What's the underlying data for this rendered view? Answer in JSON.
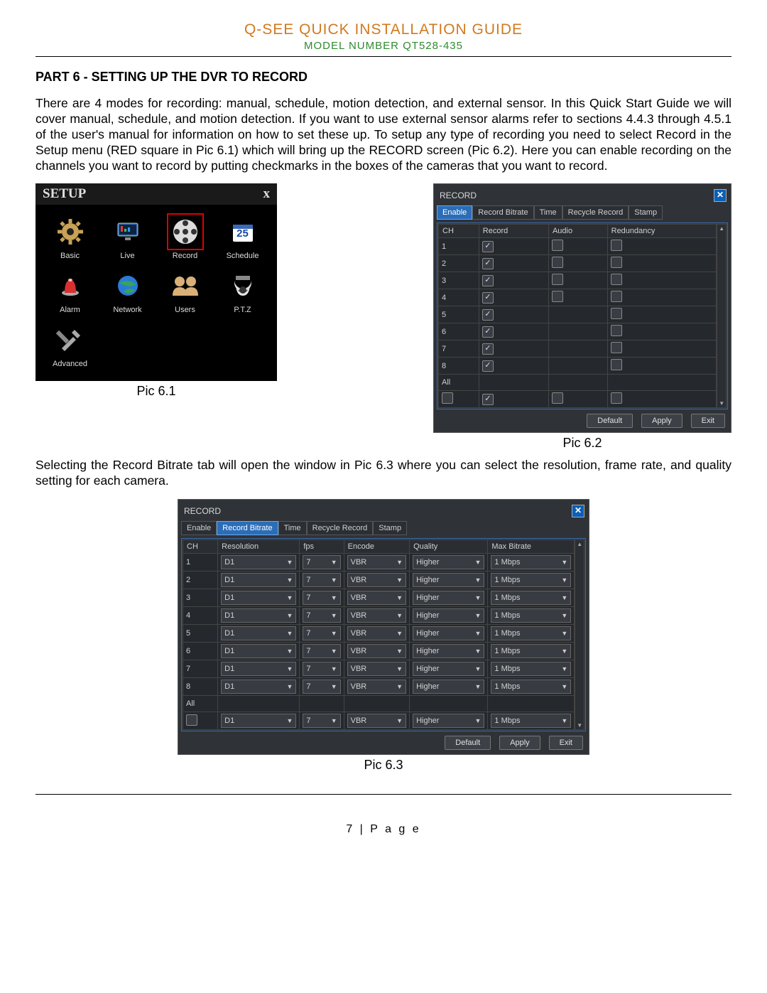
{
  "header": {
    "title": "Q-SEE QUICK INSTALLATION GUIDE",
    "model": "MODEL NUMBER QT528-435"
  },
  "section_heading": "PART 6 - SETTING UP THE DVR TO RECORD",
  "para1": "There are 4 modes for recording: manual, schedule, motion detection, and external sensor. In this Quick Start Guide we will cover manual, schedule, and motion detection. If you want to use external sensor alarms refer to sections 4.4.3 through 4.5.1 of the user's manual for information on how to set these up. To setup any type of recording you need to select Record in the Setup menu (RED square in Pic 6.1) which will bring up the RECORD screen (Pic 6.2). Here you can enable recording on the channels you want to record by putting checkmarks in the boxes of the cameras that you want to record.",
  "para2": "Selecting the Record Bitrate tab will open the window in Pic 6.3 where you can select the resolution, frame rate, and quality setting for each camera.",
  "captions": {
    "c1": "Pic 6.1",
    "c2": "Pic 6.2",
    "c3": "Pic 6.3"
  },
  "page_label": "7 | P a g e",
  "setup": {
    "title": "SETUP",
    "close": "x",
    "items": [
      "Basic",
      "Live",
      "Record",
      "Schedule",
      "Alarm",
      "Network",
      "Users",
      "P.T.Z",
      "Advanced"
    ]
  },
  "record62": {
    "title": "RECORD",
    "tabs": [
      "Enable",
      "Record Bitrate",
      "Time",
      "Recycle Record",
      "Stamp"
    ],
    "active_tab": 0,
    "headers": [
      "CH",
      "Record",
      "Audio",
      "Redundancy"
    ],
    "all_label": "All",
    "channels": [
      {
        "ch": "1",
        "record": true,
        "audio": false,
        "redundancy": false
      },
      {
        "ch": "2",
        "record": true,
        "audio": false,
        "redundancy": false
      },
      {
        "ch": "3",
        "record": true,
        "audio": false,
        "redundancy": false
      },
      {
        "ch": "4",
        "record": true,
        "audio": false,
        "redundancy": false
      },
      {
        "ch": "5",
        "record": true,
        "audio": "",
        "redundancy": false
      },
      {
        "ch": "6",
        "record": true,
        "audio": "",
        "redundancy": false
      },
      {
        "ch": "7",
        "record": true,
        "audio": "",
        "redundancy": false
      },
      {
        "ch": "8",
        "record": true,
        "audio": "",
        "redundancy": false
      }
    ],
    "all_row": {
      "record": true,
      "audio": false,
      "redundancy": false
    }
  },
  "record63": {
    "title": "RECORD",
    "tabs": [
      "Enable",
      "Record Bitrate",
      "Time",
      "Recycle Record",
      "Stamp"
    ],
    "active_tab": 1,
    "headers": [
      "CH",
      "Resolution",
      "fps",
      "Encode",
      "Quality",
      "Max Bitrate"
    ],
    "all_label": "All",
    "rows": [
      {
        "ch": "1",
        "res": "D1",
        "fps": "7",
        "enc": "VBR",
        "q": "Higher",
        "mb": "1 Mbps"
      },
      {
        "ch": "2",
        "res": "D1",
        "fps": "7",
        "enc": "VBR",
        "q": "Higher",
        "mb": "1 Mbps"
      },
      {
        "ch": "3",
        "res": "D1",
        "fps": "7",
        "enc": "VBR",
        "q": "Higher",
        "mb": "1 Mbps"
      },
      {
        "ch": "4",
        "res": "D1",
        "fps": "7",
        "enc": "VBR",
        "q": "Higher",
        "mb": "1 Mbps"
      },
      {
        "ch": "5",
        "res": "D1",
        "fps": "7",
        "enc": "VBR",
        "q": "Higher",
        "mb": "1 Mbps"
      },
      {
        "ch": "6",
        "res": "D1",
        "fps": "7",
        "enc": "VBR",
        "q": "Higher",
        "mb": "1 Mbps"
      },
      {
        "ch": "7",
        "res": "D1",
        "fps": "7",
        "enc": "VBR",
        "q": "Higher",
        "mb": "1 Mbps"
      },
      {
        "ch": "8",
        "res": "D1",
        "fps": "7",
        "enc": "VBR",
        "q": "Higher",
        "mb": "1 Mbps"
      }
    ],
    "all_row": {
      "res": "D1",
      "fps": "7",
      "enc": "VBR",
      "q": "Higher",
      "mb": "1 Mbps"
    }
  },
  "buttons": {
    "default": "Default",
    "apply": "Apply",
    "exit": "Exit"
  },
  "calendar_value": "25"
}
